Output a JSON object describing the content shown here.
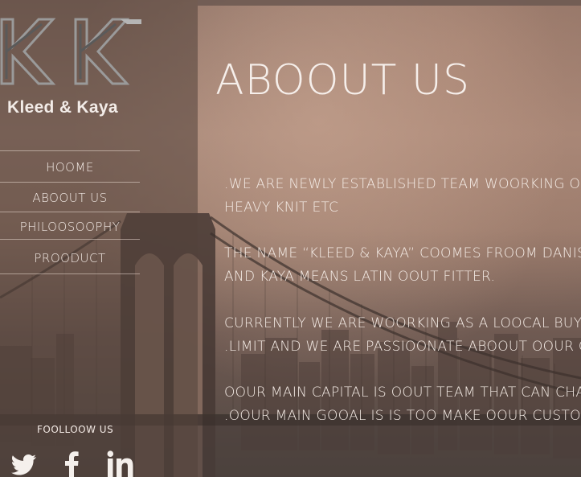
{
  "brand": {
    "name": "Kleed & Kaya",
    "mark_color": "#8b8b8b"
  },
  "nav": {
    "items": [
      {
        "label": "HOOME"
      },
      {
        "label": "ABOOUT US"
      },
      {
        "label": "PHILOOSOOPHY"
      },
      {
        "label": "PROODUCT"
      }
    ]
  },
  "social": {
    "heading": "FOOLLOOW US",
    "icons": [
      "twitter-icon",
      "facebook-icon",
      "linkedin-icon"
    ]
  },
  "main": {
    "title": "ABOOUT US",
    "paragraphs": [
      {
        "lines": [
          ".WE ARE NEWLY ESTABLISHED TEAM WOORKING OON CO",
          "HEAVY KNIT ETC"
        ]
      },
      {
        "lines": [
          "THE NAME “KLEED & KAYA” COOMES FROOM DANISH",
          "AND KAYA MEANS LATIN  OOUT FITTER."
        ]
      },
      {
        "lines": [
          " CURRENTLY WE ARE WOORKING  AS A LOOCAL BUYING",
          ".LIMIT AND WE ARE PASSIOONATE ABOOUT OOUR GOOAL"
        ]
      },
      {
        "lines": [
          "OOUR MAIN CAPITAL IS OOUT TEAM THAT CAN CHALL",
          "  .OOUR MAIN GOOAL IS IS TOO MAKE OOUR CUSTOOM"
        ]
      }
    ]
  },
  "colors": {
    "text": "#f4ebe5",
    "sidebar": "#52423a",
    "accent": "#a58576"
  }
}
